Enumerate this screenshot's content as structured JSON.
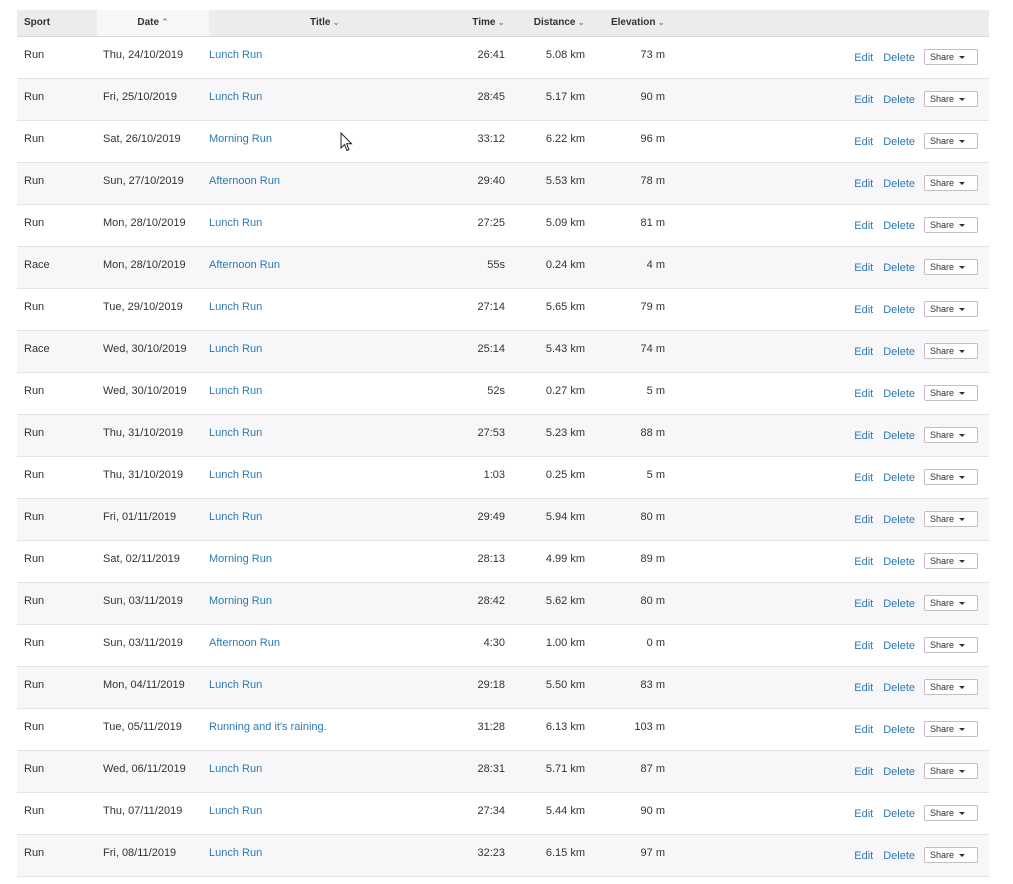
{
  "columns": {
    "sport": "Sport",
    "date": "Date",
    "title": "Title",
    "time": "Time",
    "distance": "Distance",
    "elevation": "Elevation"
  },
  "actions": {
    "edit": "Edit",
    "delete": "Delete",
    "share": "Share"
  },
  "rows": [
    {
      "sport": "Run",
      "date": "Thu, 24/10/2019",
      "title": "Lunch Run",
      "time": "26:41",
      "distance": "5.08 km",
      "elevation": "73 m"
    },
    {
      "sport": "Run",
      "date": "Fri, 25/10/2019",
      "title": "Lunch Run",
      "time": "28:45",
      "distance": "5.17 km",
      "elevation": "90 m"
    },
    {
      "sport": "Run",
      "date": "Sat, 26/10/2019",
      "title": "Morning Run",
      "time": "33:12",
      "distance": "6.22 km",
      "elevation": "96 m"
    },
    {
      "sport": "Run",
      "date": "Sun, 27/10/2019",
      "title": "Afternoon Run",
      "time": "29:40",
      "distance": "5.53 km",
      "elevation": "78 m"
    },
    {
      "sport": "Run",
      "date": "Mon, 28/10/2019",
      "title": "Lunch Run",
      "time": "27:25",
      "distance": "5.09 km",
      "elevation": "81 m"
    },
    {
      "sport": "Race",
      "date": "Mon, 28/10/2019",
      "title": "Afternoon Run",
      "time": "55s",
      "distance": "0.24 km",
      "elevation": "4 m"
    },
    {
      "sport": "Run",
      "date": "Tue, 29/10/2019",
      "title": "Lunch Run",
      "time": "27:14",
      "distance": "5.65 km",
      "elevation": "79 m"
    },
    {
      "sport": "Race",
      "date": "Wed, 30/10/2019",
      "title": "Lunch Run",
      "time": "25:14",
      "distance": "5.43 km",
      "elevation": "74 m"
    },
    {
      "sport": "Run",
      "date": "Wed, 30/10/2019",
      "title": "Lunch Run",
      "time": "52s",
      "distance": "0.27 km",
      "elevation": "5 m"
    },
    {
      "sport": "Run",
      "date": "Thu, 31/10/2019",
      "title": "Lunch Run",
      "time": "27:53",
      "distance": "5.23 km",
      "elevation": "88 m"
    },
    {
      "sport": "Run",
      "date": "Thu, 31/10/2019",
      "title": "Lunch Run",
      "time": "1:03",
      "distance": "0.25 km",
      "elevation": "5 m"
    },
    {
      "sport": "Run",
      "date": "Fri, 01/11/2019",
      "title": "Lunch Run",
      "time": "29:49",
      "distance": "5.94 km",
      "elevation": "80 m"
    },
    {
      "sport": "Run",
      "date": "Sat, 02/11/2019",
      "title": "Morning Run",
      "time": "28:13",
      "distance": "4.99 km",
      "elevation": "89 m"
    },
    {
      "sport": "Run",
      "date": "Sun, 03/11/2019",
      "title": "Morning Run",
      "time": "28:42",
      "distance": "5.62 km",
      "elevation": "80 m"
    },
    {
      "sport": "Run",
      "date": "Sun, 03/11/2019",
      "title": "Afternoon Run",
      "time": "4:30",
      "distance": "1.00 km",
      "elevation": "0 m"
    },
    {
      "sport": "Run",
      "date": "Mon, 04/11/2019",
      "title": "Lunch Run",
      "time": "29:18",
      "distance": "5.50 km",
      "elevation": "83 m"
    },
    {
      "sport": "Run",
      "date": "Tue, 05/11/2019",
      "title": "Running and it's raining.",
      "time": "31:28",
      "distance": "6.13 km",
      "elevation": "103 m"
    },
    {
      "sport": "Run",
      "date": "Wed, 06/11/2019",
      "title": "Lunch Run",
      "time": "28:31",
      "distance": "5.71 km",
      "elevation": "87 m"
    },
    {
      "sport": "Run",
      "date": "Thu, 07/11/2019",
      "title": "Lunch Run",
      "time": "27:34",
      "distance": "5.44 km",
      "elevation": "90 m"
    },
    {
      "sport": "Run",
      "date": "Fri, 08/11/2019",
      "title": "Lunch Run",
      "time": "32:23",
      "distance": "6.15 km",
      "elevation": "97 m"
    }
  ],
  "colors": {
    "link": "#2a7bb3",
    "header_bg": "#ececee",
    "row_alt": "#f7f7fa"
  }
}
